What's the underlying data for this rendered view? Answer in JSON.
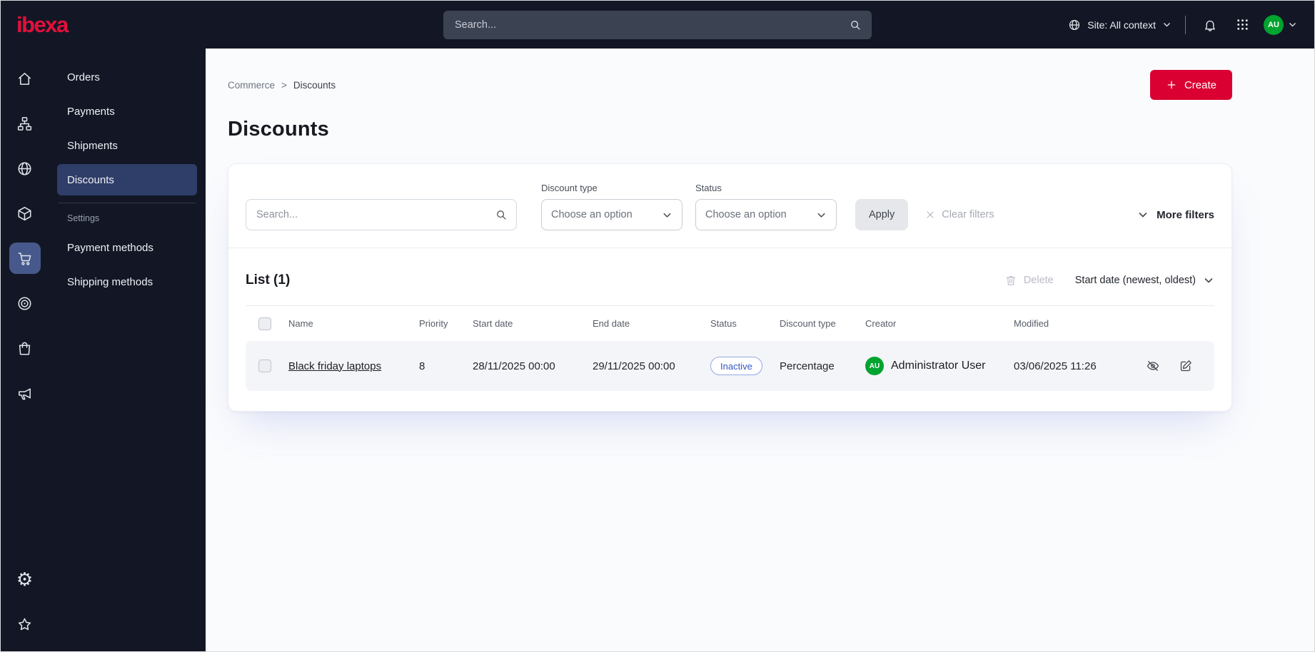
{
  "topbar": {
    "logo_text": "ibexa",
    "search_placeholder": "Search...",
    "site_context_label": "Site: All context",
    "avatar_initials": "AU"
  },
  "sidebar": {
    "rail_icons": [
      "home-icon",
      "sitemap-icon",
      "globe-icon",
      "product-catalog-icon",
      "commerce-cart-icon",
      "personalization-target-icon",
      "shop-bag-icon",
      "marketing-megaphone-icon",
      "settings-gear-icon",
      "bookmarks-star-icon"
    ],
    "menu": {
      "items": [
        {
          "label": "Orders"
        },
        {
          "label": "Payments"
        },
        {
          "label": "Shipments"
        },
        {
          "label": "Discounts",
          "active": true
        }
      ],
      "section_label": "Settings",
      "settings_items": [
        {
          "label": "Payment methods"
        },
        {
          "label": "Shipping methods"
        }
      ]
    }
  },
  "breadcrumb": {
    "parent": "Commerce",
    "separator": ">",
    "current": "Discounts"
  },
  "page": {
    "title": "Discounts"
  },
  "actions": {
    "create_label": "Create"
  },
  "filters": {
    "search_placeholder": "Search...",
    "discount_type": {
      "label": "Discount type",
      "value": "Choose an option"
    },
    "status": {
      "label": "Status",
      "value": "Choose an option"
    },
    "apply_label": "Apply",
    "clear_label": "Clear filters",
    "more_label": "More filters"
  },
  "list": {
    "title": "List (1)",
    "delete_label": "Delete",
    "sort_label": "Start date (newest, oldest)",
    "columns": [
      "Name",
      "Priority",
      "Start date",
      "End date",
      "Status",
      "Discount type",
      "Creator",
      "Modified"
    ],
    "rows": [
      {
        "name": "Black friday laptops",
        "priority": "8",
        "start_date": "28/11/2025 00:00",
        "end_date": "29/11/2025 00:00",
        "status": "Inactive",
        "discount_type": "Percentage",
        "creator_initials": "AU",
        "creator": "Administrator User",
        "modified": "03/06/2025 11:26"
      }
    ]
  },
  "colors": {
    "accent": "#db0032",
    "topbar_bg": "#131725",
    "menu_active_bg": "#2f3e68",
    "rail_active_bg": "#47598c",
    "badge_blue": "#3457c5",
    "avatar_green": "#00a42e"
  }
}
